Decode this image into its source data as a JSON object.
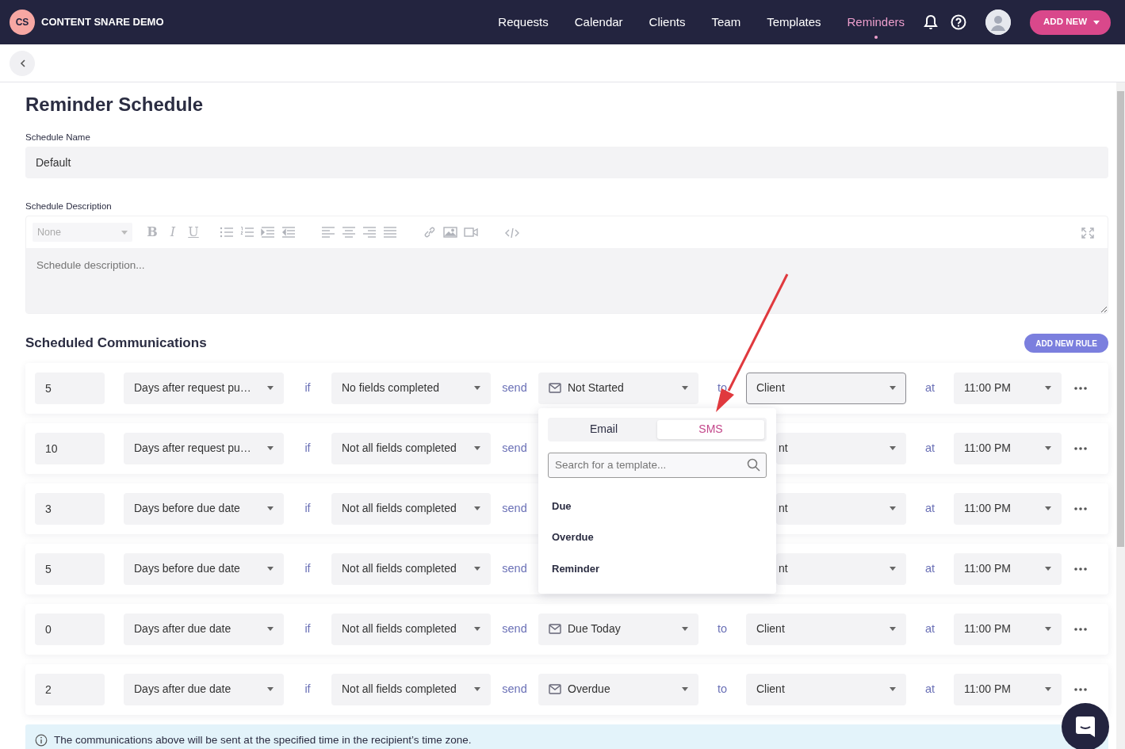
{
  "app": {
    "logo": "CS",
    "name": "CONTENT SNARE DEMO"
  },
  "nav": [
    {
      "label": "Requests",
      "selected": false
    },
    {
      "label": "Calendar",
      "selected": false
    },
    {
      "label": "Clients",
      "selected": false
    },
    {
      "label": "Team",
      "selected": false
    },
    {
      "label": "Templates",
      "selected": false
    },
    {
      "label": "Reminders",
      "selected": true
    }
  ],
  "add_new": "ADD NEW",
  "page_title": "Reminder Schedule",
  "name_field": {
    "label": "Schedule Name",
    "value": "Default"
  },
  "description": {
    "label": "Schedule Description",
    "style": "None",
    "format": [
      "B",
      "I",
      "U"
    ],
    "placeholder": "Schedule description..."
  },
  "communications": {
    "title": "Scheduled Communications",
    "add_button": "ADD NEW RULE",
    "rows": [
      {
        "amount": "5",
        "timing": "Days after request pu…",
        "if": "if",
        "condition": "No fields completed",
        "send": "send",
        "template": "Not Started",
        "to": "to",
        "recipient": "Client",
        "focused": true,
        "at": "at",
        "time": "11:00 PM"
      },
      {
        "amount": "10",
        "timing": "Days after request pu…",
        "if": "if",
        "condition": "Not all fields completed",
        "send": "send",
        "recipient": "nt",
        "focused": false,
        "at": "at",
        "time": "11:00 PM"
      },
      {
        "amount": "3",
        "timing": "Days before due date",
        "if": "if",
        "condition": "Not all fields completed",
        "send": "send",
        "recipient": "nt",
        "focused": false,
        "at": "at",
        "time": "11:00 PM"
      },
      {
        "amount": "5",
        "timing": "Days before due date",
        "if": "if",
        "condition": "Not all fields completed",
        "send": "send",
        "recipient": "nt",
        "focused": false,
        "at": "at",
        "time": "11:00 PM"
      },
      {
        "amount": "0",
        "timing": "Days after due date",
        "if": "if",
        "condition": "Not all fields completed",
        "send": "send",
        "template": "Due Today",
        "to": "to",
        "recipient": "Client",
        "focused": false,
        "at": "at",
        "time": "11:00 PM"
      },
      {
        "amount": "2",
        "timing": "Days after due date",
        "if": "if",
        "condition": "Not all fields completed",
        "send": "send",
        "template": "Overdue",
        "to": "to",
        "recipient": "Client",
        "focused": false,
        "at": "at",
        "time": "11:00 PM"
      }
    ]
  },
  "template_picker": {
    "tabs": [
      {
        "label": "Email",
        "selected": false
      },
      {
        "label": "SMS",
        "selected": true
      }
    ],
    "search_placeholder": "Search for a template...",
    "items": [
      "Due",
      "Overdue",
      "Reminder"
    ]
  },
  "info": "The communications above will be sent at the specified time in the recipient’s time zone."
}
